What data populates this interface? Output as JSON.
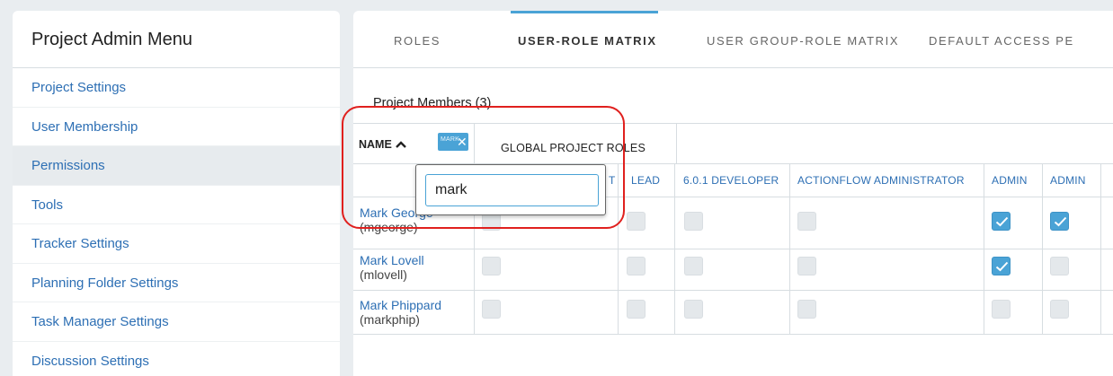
{
  "sidebar": {
    "title": "Project Admin Menu",
    "items": [
      {
        "label": "Project Settings"
      },
      {
        "label": "User Membership"
      },
      {
        "label": "Permissions"
      },
      {
        "label": "Tools"
      },
      {
        "label": "Tracker Settings"
      },
      {
        "label": "Planning Folder Settings"
      },
      {
        "label": "Task Manager Settings"
      },
      {
        "label": "Discussion Settings"
      }
    ],
    "active_item": "Permissions"
  },
  "tabs": [
    {
      "label": "ROLES"
    },
    {
      "label": "USER-ROLE MATRIX"
    },
    {
      "label": "USER GROUP-ROLE MATRIX"
    },
    {
      "label": "DEFAULT ACCESS PE"
    }
  ],
  "active_tab": "USER-ROLE MATRIX",
  "members_title": "Project Members (3)",
  "table": {
    "name_header": "NAME",
    "filter_chip": "MARK",
    "filter_chip_close": "✕",
    "group_header": "GLOBAL PROJECT ROLES",
    "columns": [
      "T",
      "LEAD",
      "6.0.1 DEVELOPER",
      "ACTIONFLOW ADMINISTRATOR",
      "ADMIN",
      "ADMIN"
    ],
    "rows": [
      {
        "name": "Mark George",
        "username": "(mgeorge)",
        "checks": [
          false,
          false,
          false,
          false,
          true,
          true
        ]
      },
      {
        "name": "Mark Lovell",
        "username": "(mlovell)",
        "checks": [
          false,
          false,
          false,
          false,
          true,
          false
        ]
      },
      {
        "name": "Mark Phippard",
        "username": "(markphip)",
        "checks": [
          false,
          false,
          false,
          false,
          false,
          false
        ]
      }
    ]
  },
  "search": {
    "value": "mark"
  },
  "colors": {
    "accent": "#4aa3d6",
    "link": "#2d6fb4",
    "highlight": "#e0201e"
  }
}
